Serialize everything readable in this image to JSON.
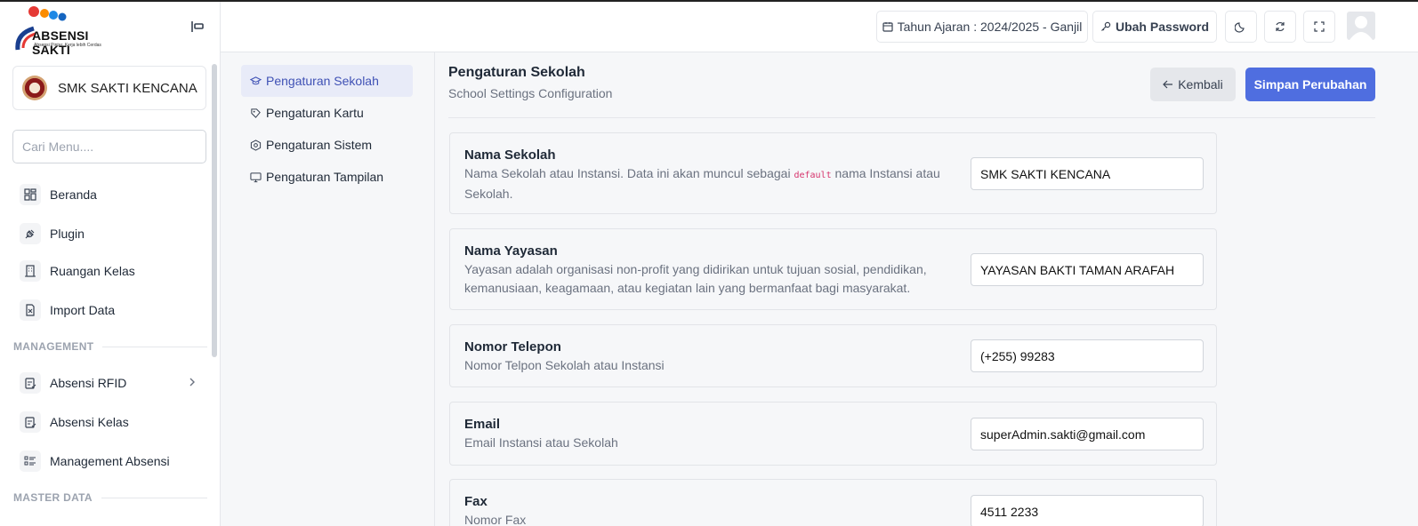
{
  "sidebar": {
    "logo_title": "ABSENSI SAKTI",
    "logo_tagline": "Absensi Pintar, Kerja lebih Cerdas",
    "school_name": "SMK SAKTI KENCANA",
    "search_placeholder": "Cari Menu....",
    "items": [
      {
        "label": "Beranda",
        "icon": "dashboard-icon"
      },
      {
        "label": "Plugin",
        "icon": "plug-icon"
      },
      {
        "label": "Ruangan Kelas",
        "icon": "building-icon"
      },
      {
        "label": "Import Data",
        "icon": "file-import-icon"
      }
    ],
    "section_management": "MANAGEMENT",
    "management_items": [
      {
        "label": "Absensi RFID",
        "icon": "clipboard-icon"
      },
      {
        "label": "Absensi Kelas",
        "icon": "clipboard-icon"
      },
      {
        "label": "Management Absensi",
        "icon": "list-icon"
      }
    ],
    "section_master": "MASTER DATA"
  },
  "topbar": {
    "academic_year": "Tahun Ajaran : 2024/2025 - Ganjil",
    "change_password": "Ubah Password"
  },
  "settings_nav": [
    {
      "label": "Pengaturan Sekolah",
      "icon": "graduation-cap-icon",
      "active": true
    },
    {
      "label": "Pengaturan Kartu",
      "icon": "tag-icon",
      "active": false
    },
    {
      "label": "Pengaturan Sistem",
      "icon": "hexagon-gear-icon",
      "active": false
    },
    {
      "label": "Pengaturan Tampilan",
      "icon": "monitor-icon",
      "active": false
    }
  ],
  "main": {
    "title": "Pengaturan Sekolah",
    "subtitle": "School Settings Configuration",
    "back_label": "Kembali",
    "save_label": "Simpan Perubahan",
    "fields": [
      {
        "label": "Nama Sekolah",
        "desc_before": "Nama Sekolah atau Instansi. Data ini akan muncul sebagai ",
        "desc_code": "default",
        "desc_after": " nama Instansi atau Sekolah.",
        "value": "SMK SAKTI KENCANA"
      },
      {
        "label": "Nama Yayasan",
        "desc": "Yayasan adalah organisasi non-profit yang didirikan untuk tujuan sosial, pendidikan, kemanusiaan, keagamaan, atau kegiatan lain yang bermanfaat bagi masyarakat.",
        "value": "YAYASAN BAKTI TAMAN ARAFAH"
      },
      {
        "label": "Nomor Telepon",
        "desc": "Nomor Telpon Sekolah atau Instansi",
        "value": "(+255) 99283"
      },
      {
        "label": "Email",
        "desc": "Email Instansi atau Sekolah",
        "value": "superAdmin.sakti@gmail.com"
      },
      {
        "label": "Fax",
        "desc": "Nomor Fax",
        "value": "4511 2233"
      }
    ]
  },
  "colors": {
    "primary": "#4f6ee0",
    "active_nav_bg": "#e8ebf8",
    "active_nav_text": "#3f51b5"
  }
}
